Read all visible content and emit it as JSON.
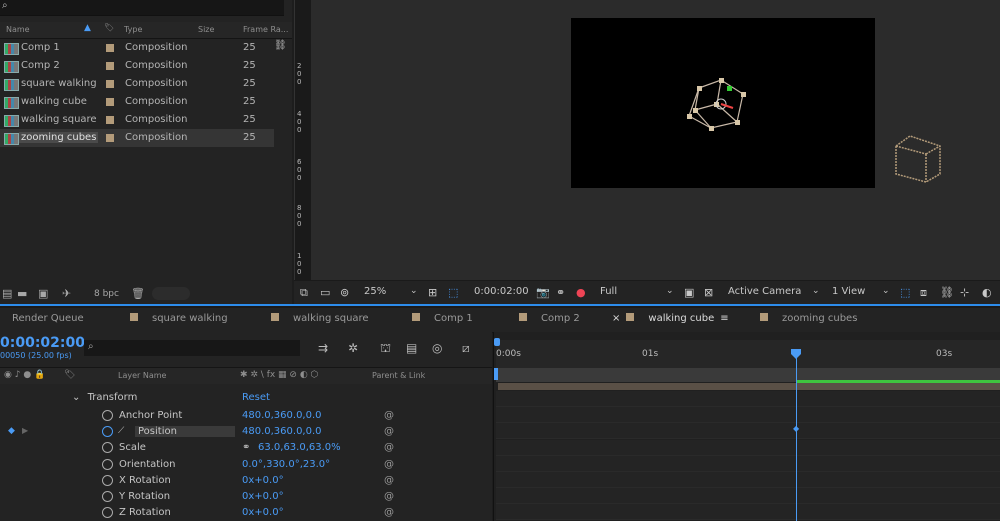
{
  "project": {
    "columns": {
      "name": "Name",
      "type": "Type",
      "size": "Size",
      "frame_rate": "Frame Ra..."
    },
    "items": [
      {
        "name": "Comp 1",
        "type": "Composition",
        "fps": "25"
      },
      {
        "name": "Comp 2",
        "type": "Composition",
        "fps": "25"
      },
      {
        "name": "square walking",
        "type": "Composition",
        "fps": "25"
      },
      {
        "name": "walking cube",
        "type": "Composition",
        "fps": "25"
      },
      {
        "name": "walking square",
        "type": "Composition",
        "fps": "25"
      },
      {
        "name": "zooming cubes",
        "type": "Composition",
        "fps": "25"
      }
    ],
    "bpc": "8 bpc"
  },
  "ruler": {
    "ticks": [
      "2",
      "0",
      "0",
      "4",
      "0",
      "0",
      "6",
      "0",
      "0",
      "8",
      "0",
      "0",
      "1",
      "0",
      "0"
    ]
  },
  "viewer_toolbar": {
    "zoom": "25%",
    "timecode": "0:00:02:00",
    "resolution": "Full",
    "camera": "Active Camera",
    "views": "1 View"
  },
  "tabs": [
    {
      "label": "Render Queue",
      "has_color": false
    },
    {
      "label": "square walking",
      "has_color": true
    },
    {
      "label": "walking square",
      "has_color": true
    },
    {
      "label": "Comp 1",
      "has_color": true
    },
    {
      "label": "Comp 2",
      "has_color": true
    },
    {
      "label": "walking cube",
      "has_color": true,
      "active": true
    },
    {
      "label": "zooming cubes",
      "has_color": true
    }
  ],
  "timeline": {
    "timecode": "0:00:02:00",
    "frame_info": "00050 (25.00 fps)",
    "header": {
      "layer_name": "Layer Name",
      "parent": "Parent & Link"
    },
    "transform_label": "Transform",
    "reset_label": "Reset",
    "properties": [
      {
        "name": "Anchor Point",
        "value": "480.0,360.0,0.0"
      },
      {
        "name": "Position",
        "value": "480.0,360.0,0.0"
      },
      {
        "name": "Scale",
        "value": "63.0,63.0,63.0%"
      },
      {
        "name": "Orientation",
        "value": "0.0°,330.0°,23.0°"
      },
      {
        "name": "X Rotation",
        "value": "0x+0.0°"
      },
      {
        "name": "Y Rotation",
        "value": "0x+0.0°"
      },
      {
        "name": "Z Rotation",
        "value": "0x+0.0°"
      }
    ],
    "time_labels": [
      "0:00s",
      "01s",
      "03s"
    ]
  },
  "colors": {
    "accent": "#4a9bf5",
    "label": "#b39b7a",
    "green": "#3fc43f"
  }
}
